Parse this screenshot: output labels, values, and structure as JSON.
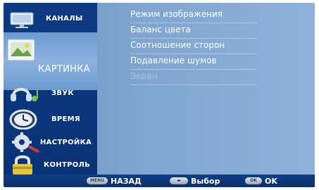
{
  "sidebar": {
    "items": [
      {
        "label": "КАНАЛЫ",
        "icon": "monitor-icon"
      },
      {
        "label": "КАРТИНКА",
        "icon": "picture-icon"
      },
      {
        "label": "ЗВУК",
        "icon": "headphones-icon"
      },
      {
        "label": "ВРЕМЯ",
        "icon": "clock-icon"
      },
      {
        "label": "НАСТРОЙКА",
        "icon": "gear-wrench-icon"
      },
      {
        "label": "КОНТРОЛЬ",
        "icon": "lock-icon"
      }
    ]
  },
  "menu": {
    "items": [
      {
        "label": "Режим изображения",
        "enabled": true
      },
      {
        "label": "Баланс цвета",
        "enabled": true
      },
      {
        "label": "Соотношение сторон",
        "enabled": true
      },
      {
        "label": "Подавление шумов",
        "enabled": true
      },
      {
        "label": "Экран",
        "enabled": false
      }
    ]
  },
  "bottom": {
    "back": {
      "key": "MENU",
      "label": "НАЗАД"
    },
    "select": {
      "key": "◂▸",
      "label": "Выбор"
    },
    "ok": {
      "key": "OK",
      "label": "OK"
    }
  },
  "colors": {
    "sidebar": "#0d3a82",
    "content": "#7fa5d0",
    "highlight": "#8db3df"
  }
}
